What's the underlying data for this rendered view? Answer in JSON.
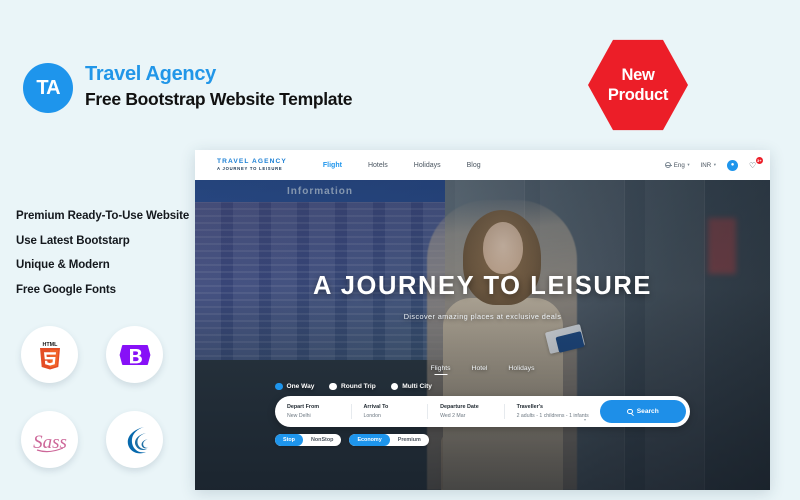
{
  "promo": {
    "logo_initials": "TA",
    "title": "Travel Agency",
    "subtitle": "Free Bootstrap Website Template",
    "badge_line1": "New",
    "badge_line2": "Product",
    "accent_blue": "#2196e8",
    "badge_red": "#ec1e28"
  },
  "features": [
    "Premium Ready-To-Use Website",
    "Use Latest Bootstarp",
    "Unique & Modern",
    "Free Google Fonts"
  ],
  "tech": [
    {
      "name": "html5-icon",
      "label": "HTML5"
    },
    {
      "name": "bootstrap-icon",
      "label": "Bootstrap"
    },
    {
      "name": "sass-icon",
      "label": "Sass"
    },
    {
      "name": "jquery-icon",
      "label": "jQuery"
    }
  ],
  "site": {
    "brand_top": "TRAVEL AGENCY",
    "brand_bottom": "A JOURNEY TO LEISURE",
    "nav": [
      {
        "label": "Flight",
        "active": true
      },
      {
        "label": "Hotels",
        "active": false
      },
      {
        "label": "Holidays",
        "active": false
      },
      {
        "label": "Blog",
        "active": false
      }
    ],
    "nav_right": {
      "language": "Eng",
      "currency": "INR",
      "caret": "▾",
      "avatar_glyph": "●",
      "bell_glyph": "♡",
      "bell_badge": "3+"
    },
    "board_header": "Information",
    "hero": {
      "title": "A JOURNEY TO LEISURE",
      "subtitle": "Discover amazing places at exclusive deals"
    },
    "widget": {
      "tabs": [
        {
          "label": "Flights",
          "active": true
        },
        {
          "label": "Hotel",
          "active": false
        },
        {
          "label": "Holidays",
          "active": false
        }
      ],
      "trip_types": [
        {
          "label": "One Way",
          "selected": true
        },
        {
          "label": "Round Trip",
          "selected": false
        },
        {
          "label": "Multi City",
          "selected": false
        }
      ],
      "fields": [
        {
          "label": "Depart From",
          "value": "New Delhi"
        },
        {
          "label": "Arrival To",
          "value": "London"
        },
        {
          "label": "Departure Date",
          "value": "Wed 2 Mar"
        },
        {
          "label": "Traveller's",
          "value": "2 adults - 1 childrens - 1 infants"
        }
      ],
      "search_label": "Search",
      "chip_groups": [
        [
          {
            "label": "Stop",
            "active": true
          },
          {
            "label": "NonStop",
            "active": false
          }
        ],
        [
          {
            "label": "Economy",
            "active": true
          },
          {
            "label": "Premium",
            "active": false
          }
        ]
      ]
    }
  }
}
